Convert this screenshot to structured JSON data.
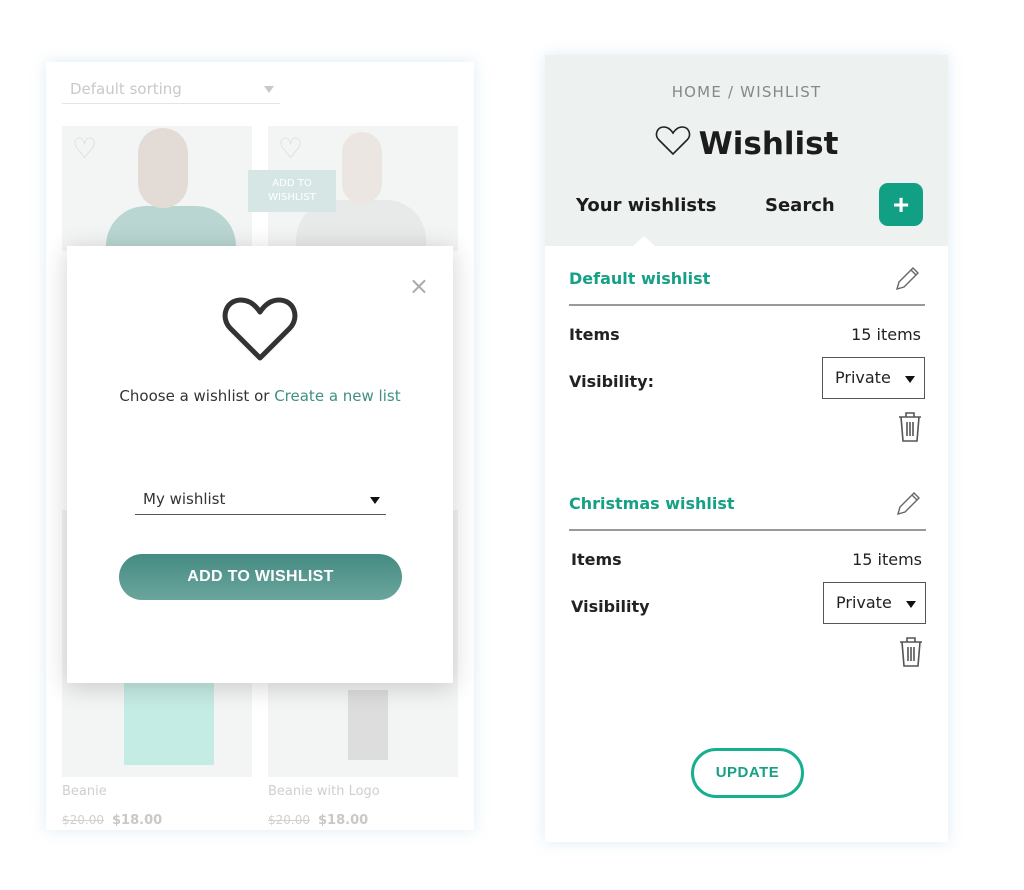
{
  "shop": {
    "sorting": "Default sorting",
    "tooltip": "ADD TO WISHLIST",
    "products": [
      {
        "name": "Beanie",
        "old_price": "$20.00",
        "price": "$18.00"
      },
      {
        "name": "Beanie with Logo",
        "old_price": "$20.00",
        "price": "$18.00"
      }
    ]
  },
  "modal": {
    "prompt": "Choose a wishlist or ",
    "create_link": "Create a new list",
    "selected_wishlist": "My wishlist",
    "add_button": "ADD TO WISHLIST",
    "close": "×"
  },
  "wishlist_page": {
    "breadcrumb": "HOME / WISHLIST",
    "title": "Wishlist",
    "tabs": [
      "Your wishlists",
      "Search"
    ],
    "add": "+",
    "accent": "#16a085",
    "lists": [
      {
        "name": "Default wishlist",
        "items_label": "Items",
        "items_value": "15 items",
        "visibility_label": "Visibility:",
        "visibility": "Private"
      },
      {
        "name": "Christmas wishlist",
        "items_label": "Items",
        "items_value": "15 items",
        "visibility_label": "Visibility",
        "visibility": "Private"
      }
    ],
    "update": "UPDATE"
  }
}
